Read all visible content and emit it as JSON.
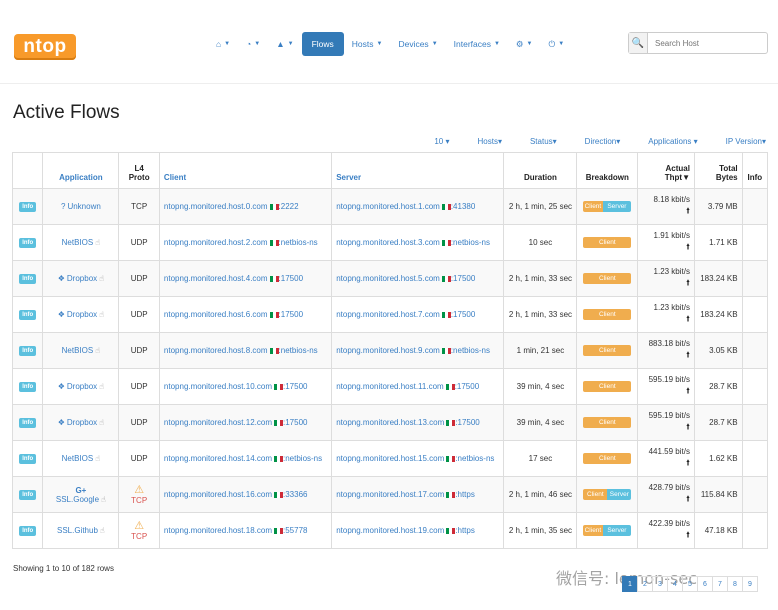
{
  "logo": "ntop",
  "nav": {
    "home_icon": "home-icon",
    "dashboard_icon": "dashboard-icon",
    "alerts_icon": "warning-icon",
    "items": [
      "Flows",
      "Hosts",
      "Devices",
      "Interfaces"
    ],
    "settings_icon": "gear-icon",
    "power_icon": "power-icon"
  },
  "search": {
    "placeholder": "Search Host",
    "icon": "search-icon"
  },
  "page_title": "Active Flows",
  "toolbar": [
    "10",
    "Hosts",
    "Status",
    "Direction",
    "Applications",
    "IP Version"
  ],
  "columns": {
    "btn": "",
    "app": "Application",
    "proto_line1": "L4",
    "proto_line2": "Proto",
    "client": "Client",
    "server": "Server",
    "duration": "Duration",
    "breakdown": "Breakdown",
    "thpt_line1": "Actual",
    "thpt_line2": "Thpt",
    "bytes_line1": "Total",
    "bytes_line2": "Bytes",
    "info": "Info"
  },
  "info_label": "Info",
  "rows": [
    {
      "app": "Unknown",
      "proto": "TCP",
      "client": "ntopng.monitored.host.0.com",
      "client_port": ":2222",
      "server": "ntopng.monitored.host.1.com",
      "server_port": ":41380",
      "duration": "2 h, 1 min, 25 sec",
      "thpt": "8.18 kbit/s",
      "bytes": "3.79 MB"
    },
    {
      "app": "NetBIOS",
      "proto": "UDP",
      "client": "ntopng.monitored.host.2.com",
      "client_port": ":netbios-ns",
      "server": "ntopng.monitored.host.3.com",
      "server_port": ":netbios-ns",
      "duration": "10 sec",
      "thpt": "1.91 kbit/s",
      "bytes": "1.71 KB"
    },
    {
      "app": "Dropbox",
      "proto": "UDP",
      "client": "ntopng.monitored.host.4.com",
      "client_port": ":17500",
      "server": "ntopng.monitored.host.5.com",
      "server_port": ":17500",
      "duration": "2 h, 1 min, 33 sec",
      "thpt": "1.23 kbit/s",
      "bytes": "183.24 KB"
    },
    {
      "app": "Dropbox",
      "proto": "UDP",
      "client": "ntopng.monitored.host.6.com",
      "client_port": ":17500",
      "server": "ntopng.monitored.host.7.com",
      "server_port": ":17500",
      "duration": "2 h, 1 min, 33 sec",
      "thpt": "1.23 kbit/s",
      "bytes": "183.24 KB"
    },
    {
      "app": "NetBIOS",
      "proto": "UDP",
      "client": "ntopng.monitored.host.8.com",
      "client_port": ":netbios-ns",
      "server": "ntopng.monitored.host.9.com",
      "server_port": ":netbios-ns",
      "duration": "1 min, 21 sec",
      "thpt": "883.18 bit/s",
      "bytes": "3.05 KB"
    },
    {
      "app": "Dropbox",
      "proto": "UDP",
      "client": "ntopng.monitored.host.10.com",
      "client_port": ":17500",
      "server": "ntopng.monitored.host.11.com",
      "server_port": ":17500",
      "duration": "39 min, 4 sec",
      "thpt": "595.19 bit/s",
      "bytes": "28.7 KB"
    },
    {
      "app": "Dropbox",
      "proto": "UDP",
      "client": "ntopng.monitored.host.12.com",
      "client_port": ":17500",
      "server": "ntopng.monitored.host.13.com",
      "server_port": ":17500",
      "duration": "39 min, 4 sec",
      "thpt": "595.19 bit/s",
      "bytes": "28.7 KB"
    },
    {
      "app": "NetBIOS",
      "proto": "UDP",
      "client": "ntopng.monitored.host.14.com",
      "client_port": ":netbios-ns",
      "server": "ntopng.monitored.host.15.com",
      "server_port": ":netbios-ns",
      "duration": "17 sec",
      "thpt": "441.59 bit/s",
      "bytes": "1.62 KB"
    },
    {
      "app": "SSL.Google",
      "proto": "TCP",
      "client": "ntopng.monitored.host.16.com",
      "client_port": ":33366",
      "server": "ntopng.monitored.host.17.com",
      "server_port": ":https",
      "duration": "2 h, 1 min, 46 sec",
      "thpt": "428.79 bit/s",
      "bytes": "115.84 KB"
    },
    {
      "app": "SSL.Github",
      "proto": "TCP",
      "client": "ntopng.monitored.host.18.com",
      "client_port": ":55778",
      "server": "ntopng.monitored.host.19.com",
      "server_port": ":https",
      "duration": "2 h, 1 min, 35 sec",
      "thpt": "422.39 bit/s",
      "bytes": "47.18 KB"
    }
  ],
  "breakdown_labels": {
    "client": "Client",
    "server": "Server"
  },
  "footer": "Showing 1 to 10 of 182 rows",
  "pager": [
    "1",
    "2",
    "3",
    "4",
    "5",
    "6",
    "7",
    "8",
    "9"
  ],
  "watermark": "微信号: lemon-sec"
}
